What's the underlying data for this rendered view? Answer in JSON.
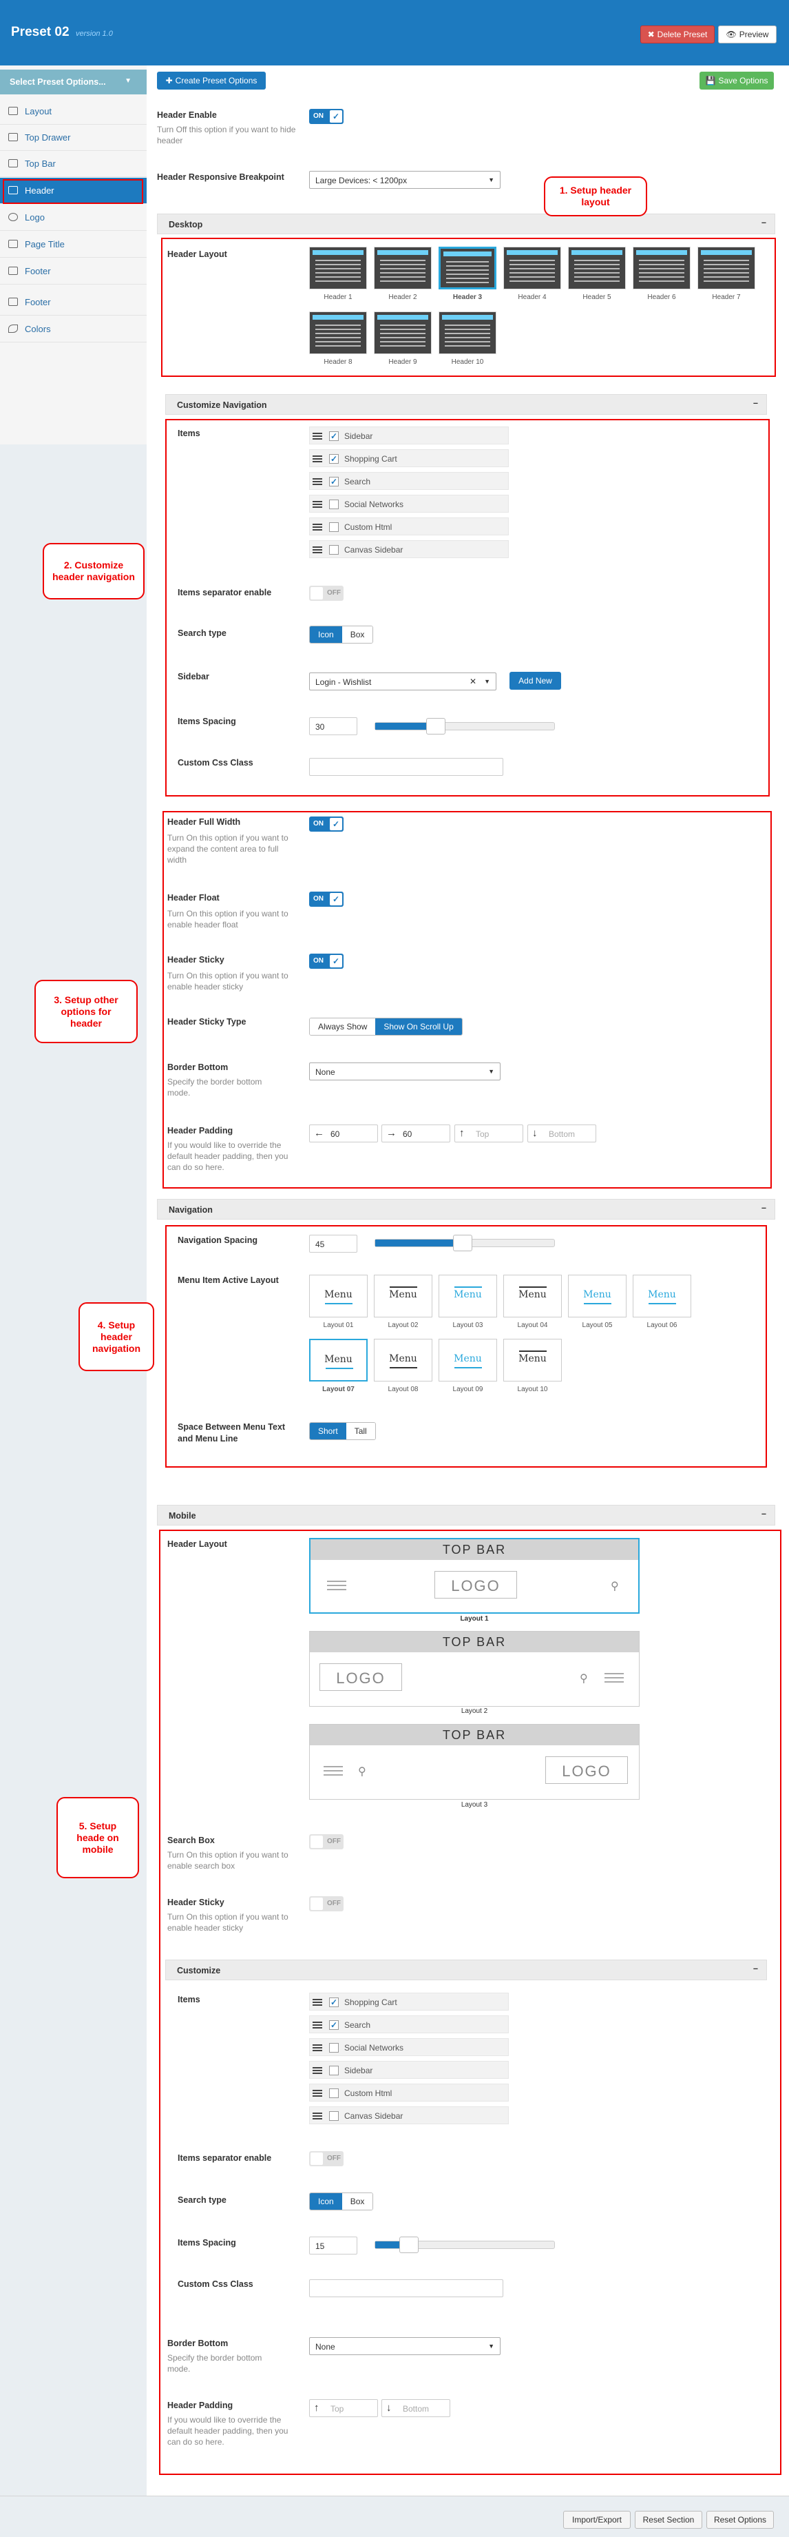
{
  "header": {
    "title": "Preset 02",
    "version": "version 1.0",
    "delete_label": "Delete Preset",
    "preview_label": "Preview"
  },
  "sidebar": {
    "select_label": "Select Preset Options...",
    "items": [
      {
        "label": "Layout"
      },
      {
        "label": "Top Drawer"
      },
      {
        "label": "Top Bar"
      },
      {
        "label": "Header"
      },
      {
        "label": "Logo"
      },
      {
        "label": "Page Title"
      },
      {
        "label": "Footer"
      },
      {
        "label": "Footer"
      },
      {
        "label": "Colors"
      }
    ]
  },
  "toolbar": {
    "create_label": "Create Preset Options",
    "save_label": "Save Options"
  },
  "general": {
    "header_enable_label": "Header Enable",
    "header_enable_desc": "Turn Off this option if you want to hide header",
    "breakpoint_label": "Header Responsive Breakpoint",
    "breakpoint_value": "Large Devices: < 1200px",
    "on": "ON",
    "off": "OFF"
  },
  "desktop": {
    "title": "Desktop",
    "layout_label": "Header Layout",
    "layouts": [
      "Header 1",
      "Header 2",
      "Header 3",
      "Header 4",
      "Header 5",
      "Header 6",
      "Header 7",
      "Header 8",
      "Header 9",
      "Header 10"
    ]
  },
  "custom_nav": {
    "title": "Customize Navigation",
    "items_label": "Items",
    "items": [
      {
        "label": "Sidebar",
        "checked": true
      },
      {
        "label": "Shopping Cart",
        "checked": true
      },
      {
        "label": "Search",
        "checked": true
      },
      {
        "label": "Social Networks",
        "checked": false
      },
      {
        "label": "Custom Html",
        "checked": false
      },
      {
        "label": "Canvas Sidebar",
        "checked": false
      }
    ],
    "separator_label": "Items separator enable",
    "search_type_label": "Search type",
    "search_icon": "Icon",
    "search_box": "Box",
    "sidebar_label": "Sidebar",
    "sidebar_value": "Login - Wishlist",
    "add_new": "Add New",
    "spacing_label": "Items Spacing",
    "spacing_value": "30",
    "spacing_fraction": 0.3,
    "css_label": "Custom Css Class"
  },
  "options": {
    "full_width_label": "Header Full Width",
    "full_width_desc": "Turn On this option if you want to expand the content area to full width",
    "float_label": "Header Float",
    "float_desc": "Turn On this option if you want to enable header float",
    "sticky_label": "Header Sticky",
    "sticky_desc": "Turn On this option if you want to enable header sticky",
    "sticky_type_label": "Header Sticky Type",
    "sticky_always": "Always Show",
    "sticky_scroll": "Show On Scroll Up",
    "border_label": "Border Bottom",
    "border_desc": "Specify the border bottom mode.",
    "border_value": "None",
    "padding_label": "Header Padding",
    "padding_desc": "If you would like to override the default header padding, then you can do so here.",
    "padding_left": "60",
    "padding_right": "60",
    "padding_top_ph": "Top",
    "padding_bottom_ph": "Bottom"
  },
  "navigation": {
    "title": "Navigation",
    "spacing_label": "Navigation Spacing",
    "spacing_value": "45",
    "spacing_fraction": 0.45,
    "active_label": "Menu Item Active Layout",
    "menu_word": "Menu",
    "layouts": [
      "Layout 01",
      "Layout 02",
      "Layout 03",
      "Layout 04",
      "Layout 05",
      "Layout 06",
      "Layout 07",
      "Layout 08",
      "Layout 09",
      "Layout 10"
    ],
    "space_label": "Space Between Menu Text and Menu Line",
    "space_short": "Short",
    "space_tall": "Tall"
  },
  "mobile": {
    "title": "Mobile",
    "layout_label": "Header Layout",
    "top_bar": "TOP BAR",
    "logo": "LOGO",
    "layouts": [
      "Layout 1",
      "Layout 2",
      "Layout 3"
    ],
    "search_box_label": "Search Box",
    "search_box_desc": "Turn On this option if you want to enable search box",
    "sticky_label": "Header Sticky",
    "sticky_desc": "Turn On this option if you want to enable header sticky",
    "customize_title": "Customize",
    "items_label": "Items",
    "items": [
      {
        "label": "Shopping Cart",
        "checked": true
      },
      {
        "label": "Search",
        "checked": true
      },
      {
        "label": "Social Networks",
        "checked": false
      },
      {
        "label": "Sidebar",
        "checked": false
      },
      {
        "label": "Custom Html",
        "checked": false
      },
      {
        "label": "Canvas Sidebar",
        "checked": false
      }
    ],
    "separator_label": "Items separator enable",
    "search_type_label": "Search type",
    "search_icon": "Icon",
    "search_box": "Box",
    "spacing_label": "Items Spacing",
    "spacing_value": "15",
    "spacing_fraction": 0.15,
    "css_label": "Custom Css Class",
    "border_label": "Border Bottom",
    "border_desc": "Specify the border bottom mode.",
    "border_value": "None",
    "padding_label": "Header Padding",
    "padding_desc": "If you would like to override the default header padding, then you can do so here.",
    "padding_top_ph": "Top",
    "padding_bottom_ph": "Bottom"
  },
  "callouts": [
    "1. Setup header layout",
    "2. Customize header navigation",
    "3. Setup other options for header",
    "4. Setup header navigation",
    "5. Setup heade on mobile"
  ],
  "footer": {
    "import_label": "Import/Export",
    "reset_section_label": "Reset Section",
    "reset_options_label": "Reset Options"
  },
  "colors": {
    "primary": "#1d7abf",
    "danger": "#d9534f",
    "success": "#5cb85c",
    "highlight": "#2aa8dc",
    "annotation": "#e00000"
  }
}
